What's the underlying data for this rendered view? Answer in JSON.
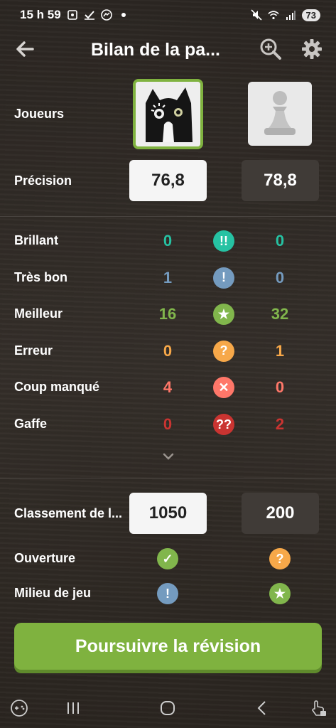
{
  "status_bar": {
    "time": "15 h 59",
    "battery": "73"
  },
  "header": {
    "title": "Bilan de la pa..."
  },
  "players": {
    "label": "Joueurs"
  },
  "precision": {
    "label": "Précision",
    "white": "76,8",
    "black": "78,8"
  },
  "moves": [
    {
      "label": "Brillant",
      "white": "0",
      "black": "0",
      "symbol": "!!",
      "color": "#26c2a3",
      "icon": "brilliant-icon"
    },
    {
      "label": "Très bon",
      "white": "1",
      "black": "0",
      "symbol": "!",
      "color": "#749bbf",
      "icon": "great-move-icon"
    },
    {
      "label": "Meilleur",
      "white": "16",
      "black": "32",
      "symbol": "★",
      "color": "#81b64c",
      "icon": "star-icon"
    },
    {
      "label": "Erreur",
      "white": "0",
      "black": "1",
      "symbol": "?",
      "color": "#f7a849",
      "icon": "mistake-icon"
    },
    {
      "label": "Coup manqué",
      "white": "4",
      "black": "0",
      "symbol": "✕",
      "color": "#ff7769",
      "icon": "miss-icon"
    },
    {
      "label": "Gaffe",
      "white": "0",
      "black": "2",
      "symbol": "??",
      "color": "#ca3431",
      "icon": "blunder-icon"
    }
  ],
  "rating": {
    "label": "Classement de l...",
    "white": "1050",
    "black": "200"
  },
  "phases": [
    {
      "label": "Ouverture",
      "white_icon": "check-icon",
      "white_symbol": "✓",
      "white_color": "#81b64c",
      "black_icon": "mistake-icon",
      "black_symbol": "?",
      "black_color": "#f7a849"
    },
    {
      "label": "Milieu de jeu",
      "white_icon": "great-move-icon",
      "white_symbol": "!",
      "white_color": "#749bbf",
      "black_icon": "star-icon",
      "black_symbol": "★",
      "black_color": "#81b64c"
    }
  ],
  "cta": {
    "label": "Poursuivre la révision"
  }
}
